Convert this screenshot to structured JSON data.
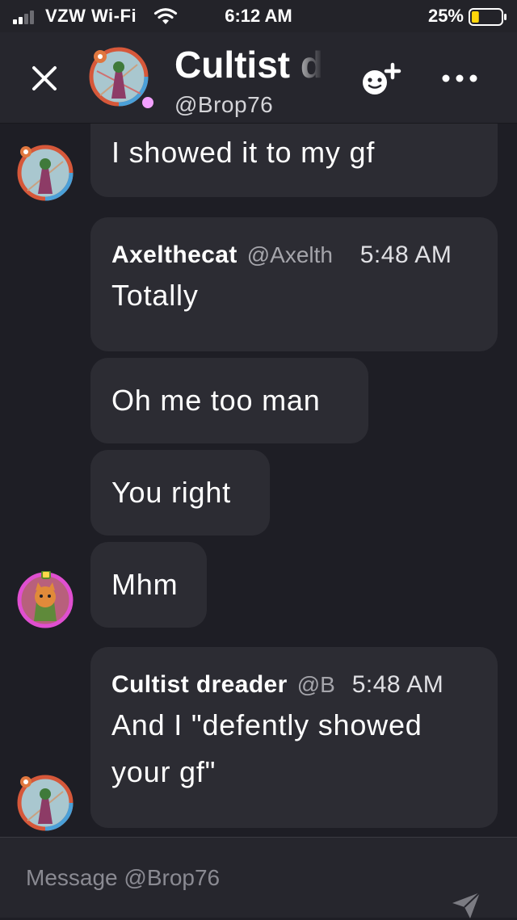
{
  "status_bar": {
    "carrier": "VZW Wi-Fi",
    "time": "6:12 AM",
    "battery": "25%",
    "battery_level": 0.25
  },
  "header": {
    "title": "Cultist d",
    "handle": "@Brop76",
    "status_color": "#f3a0ff",
    "icons": [
      "close-icon",
      "add-friend-icon",
      "more-icon"
    ]
  },
  "messages": [
    {
      "text": "I showed it to my gf"
    },
    {
      "author": "Axelthecat",
      "handle": "@Axelth",
      "time": "5:48 AM",
      "text": "Totally"
    },
    {
      "text": "Oh me too man"
    },
    {
      "text": "You right"
    },
    {
      "text": "Mhm"
    },
    {
      "author": "Cultist dreader",
      "handle": "@B",
      "time": "5:48 AM",
      "text_line1": "And I \"defently showed",
      "text_line2": "your gf\""
    }
  ],
  "composer": {
    "placeholder": "Message @Brop76"
  },
  "colors": {
    "background": "#1e1e25",
    "header": "#26262d",
    "bubble": "#2c2c33",
    "status_online": "#f3a0ff"
  }
}
